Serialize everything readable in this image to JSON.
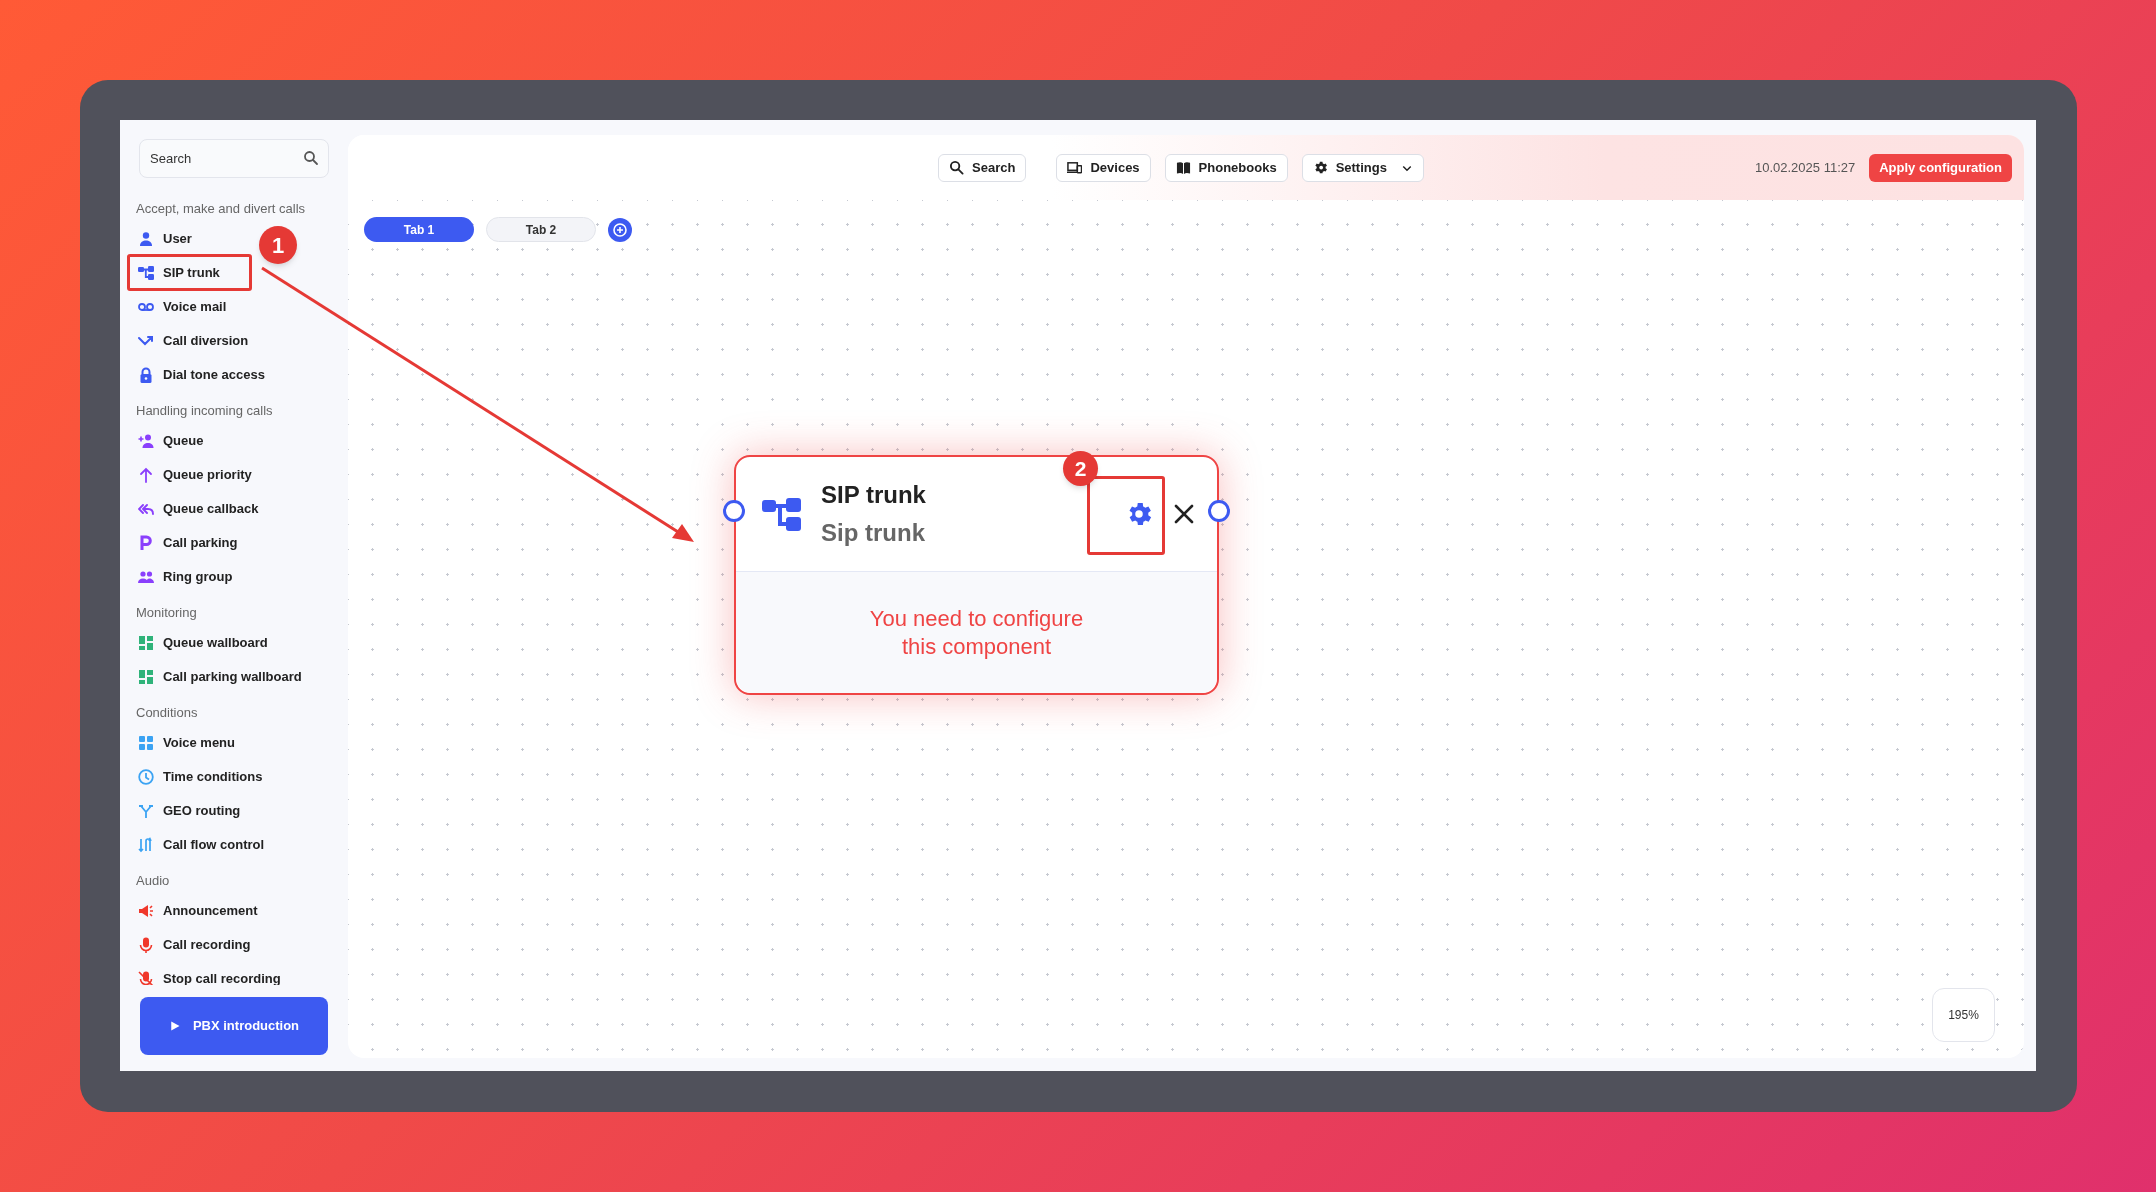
{
  "sidebar": {
    "search": {
      "placeholder": "Search"
    },
    "sections": [
      {
        "title": "Accept, make and divert calls",
        "color": "#3d5af1",
        "items": [
          {
            "label": "User"
          },
          {
            "label": "SIP trunk"
          },
          {
            "label": "Voice mail"
          },
          {
            "label": "Call diversion"
          },
          {
            "label": "Dial tone access"
          }
        ]
      },
      {
        "title": "Handling incoming calls",
        "color": "#8a3ffc",
        "items": [
          {
            "label": "Queue"
          },
          {
            "label": "Queue priority"
          },
          {
            "label": "Queue callback"
          },
          {
            "label": "Call parking"
          },
          {
            "label": "Ring group"
          }
        ]
      },
      {
        "title": "Monitoring",
        "color": "#2fb37a",
        "items": [
          {
            "label": "Queue wallboard"
          },
          {
            "label": "Call parking wallboard"
          }
        ]
      },
      {
        "title": "Conditions",
        "color": "#3ba3f3",
        "items": [
          {
            "label": "Voice menu"
          },
          {
            "label": "Time conditions"
          },
          {
            "label": "GEO routing"
          },
          {
            "label": "Call flow control"
          }
        ]
      },
      {
        "title": "Audio",
        "color": "#f0382b",
        "items": [
          {
            "label": "Announcement"
          },
          {
            "label": "Call recording"
          },
          {
            "label": "Stop call recording"
          }
        ]
      }
    ],
    "intro_button": {
      "label": "PBX introduction"
    }
  },
  "toolbar": {
    "buttons": [
      {
        "label": "Search",
        "kind": "button"
      },
      {
        "label": "Devices",
        "kind": "button"
      },
      {
        "label": "Phonebooks",
        "kind": "button"
      },
      {
        "label": "Settings",
        "kind": "dropdown"
      }
    ],
    "datetime": "10.02.2025 11:27",
    "apply_button": "Apply configuration"
  },
  "tabs": [
    {
      "label": "Tab 1",
      "selected": true
    },
    {
      "label": "Tab 2",
      "selected": false
    }
  ],
  "node": {
    "title": "SIP trunk",
    "subtitle": "Sip trunk",
    "message": "You need to configure this component"
  },
  "zoom": "195%",
  "annotations": [
    {
      "label": "1"
    },
    {
      "label": "2"
    }
  ]
}
